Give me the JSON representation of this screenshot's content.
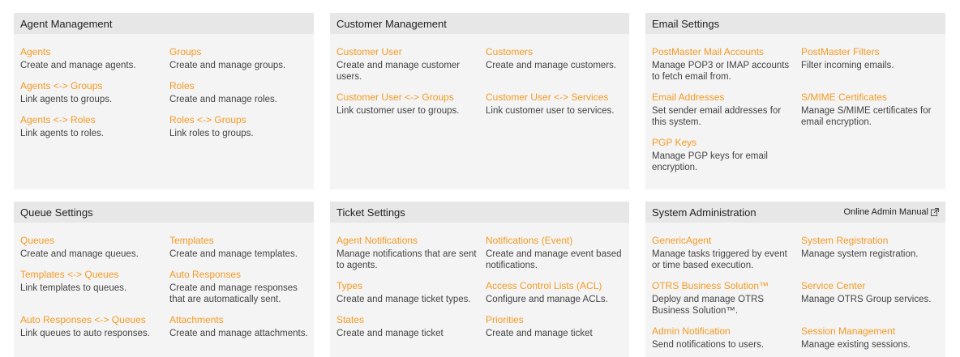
{
  "panels": {
    "agent_management": {
      "title": "Agent Management",
      "items": [
        {
          "label": "Agents",
          "desc": "Create and manage agents."
        },
        {
          "label": "Groups",
          "desc": "Create and manage groups."
        },
        {
          "label": "Agents <-> Groups",
          "desc": "Link agents to groups."
        },
        {
          "label": "Roles",
          "desc": "Create and manage roles."
        },
        {
          "label": "Agents <-> Roles",
          "desc": "Link agents to roles."
        },
        {
          "label": "Roles <-> Groups",
          "desc": "Link roles to groups."
        }
      ]
    },
    "customer_management": {
      "title": "Customer Management",
      "items": [
        {
          "label": "Customer User",
          "desc": "Create and manage customer users."
        },
        {
          "label": "Customers",
          "desc": "Create and manage customers."
        },
        {
          "label": "Customer User <-> Groups",
          "desc": "Link customer user to groups."
        },
        {
          "label": "Customer User <-> Services",
          "desc": "Link customer user to services."
        }
      ]
    },
    "email_settings": {
      "title": "Email Settings",
      "items": [
        {
          "label": "PostMaster Mail Accounts",
          "desc": "Manage POP3 or IMAP accounts to fetch email from."
        },
        {
          "label": "PostMaster Filters",
          "desc": "Filter incoming emails."
        },
        {
          "label": "Email Addresses",
          "desc": "Set sender email addresses for this system."
        },
        {
          "label": "S/MIME Certificates",
          "desc": "Manage S/MIME certificates for email encryption."
        },
        {
          "label": "PGP Keys",
          "desc": "Manage PGP keys for email encryption."
        }
      ]
    },
    "queue_settings": {
      "title": "Queue Settings",
      "items": [
        {
          "label": "Queues",
          "desc": "Create and manage queues."
        },
        {
          "label": "Templates",
          "desc": "Create and manage templates."
        },
        {
          "label": "Templates <-> Queues",
          "desc": "Link templates to queues."
        },
        {
          "label": "Auto Responses",
          "desc": "Create and manage responses that are automatically sent."
        },
        {
          "label": "Auto Responses <-> Queues",
          "desc": "Link queues to auto responses."
        },
        {
          "label": "Attachments",
          "desc": "Create and manage attachments."
        }
      ]
    },
    "ticket_settings": {
      "title": "Ticket Settings",
      "items": [
        {
          "label": "Agent Notifications",
          "desc": "Manage notifications that are sent to agents."
        },
        {
          "label": "Notifications (Event)",
          "desc": "Create and manage event based notifications."
        },
        {
          "label": "Types",
          "desc": "Create and manage ticket types."
        },
        {
          "label": "Access Control Lists (ACL)",
          "desc": "Configure and manage ACLs."
        },
        {
          "label": "States",
          "desc": "Create and manage ticket"
        },
        {
          "label": "Priorities",
          "desc": "Create and manage ticket"
        }
      ]
    },
    "system_administration": {
      "title": "System Administration",
      "header_link": "Online Admin Manual",
      "header_link_icon": "external-link-icon",
      "items": [
        {
          "label": "GenericAgent",
          "desc": "Manage tasks triggered by event or time based execution."
        },
        {
          "label": "System Registration",
          "desc": "Manage system registration."
        },
        {
          "label": "OTRS Business Solution™",
          "desc": "Deploy and manage OTRS Business Solution™."
        },
        {
          "label": "Service Center",
          "desc": "Manage OTRS Group services."
        },
        {
          "label": "Admin Notification",
          "desc": "Send notifications to users."
        },
        {
          "label": "Session Management",
          "desc": "Manage existing sessions."
        }
      ]
    }
  },
  "colors": {
    "link": "#f39a24",
    "panel_bg": "#f4f4f4",
    "header_bg": "#e7e7e7"
  }
}
